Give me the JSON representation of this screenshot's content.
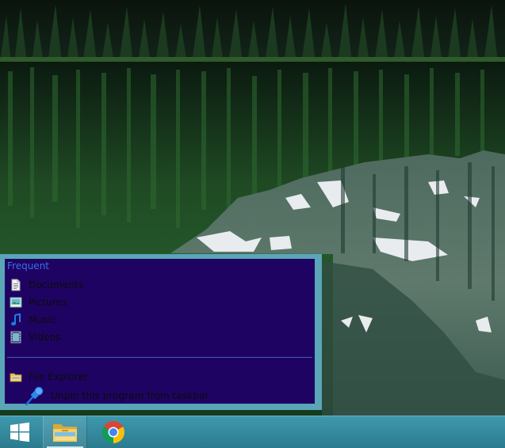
{
  "jumplist": {
    "heading": "Frequent",
    "items": [
      {
        "label": "Documents",
        "icon": "documents-icon"
      },
      {
        "label": "Pictures",
        "icon": "pictures-icon"
      },
      {
        "label": "Music",
        "icon": "music-icon"
      },
      {
        "label": "Videos",
        "icon": "videos-icon"
      }
    ],
    "tasks": [
      {
        "label": "File Explorer",
        "icon": "file-explorer-icon"
      },
      {
        "label": "Unpin this program from taskbar",
        "icon": "pin-icon"
      }
    ]
  },
  "taskbar": {
    "buttons": [
      {
        "name": "start",
        "icon": "windows-logo-icon"
      },
      {
        "name": "file-explorer",
        "icon": "folder-icon",
        "active": true
      },
      {
        "name": "chrome",
        "icon": "chrome-icon"
      }
    ]
  },
  "colors": {
    "jumplist_frame": "#5aa6b8",
    "jumplist_bg": "#1f0363",
    "heading": "#3a6fe8",
    "taskbar": "#3488a0"
  }
}
